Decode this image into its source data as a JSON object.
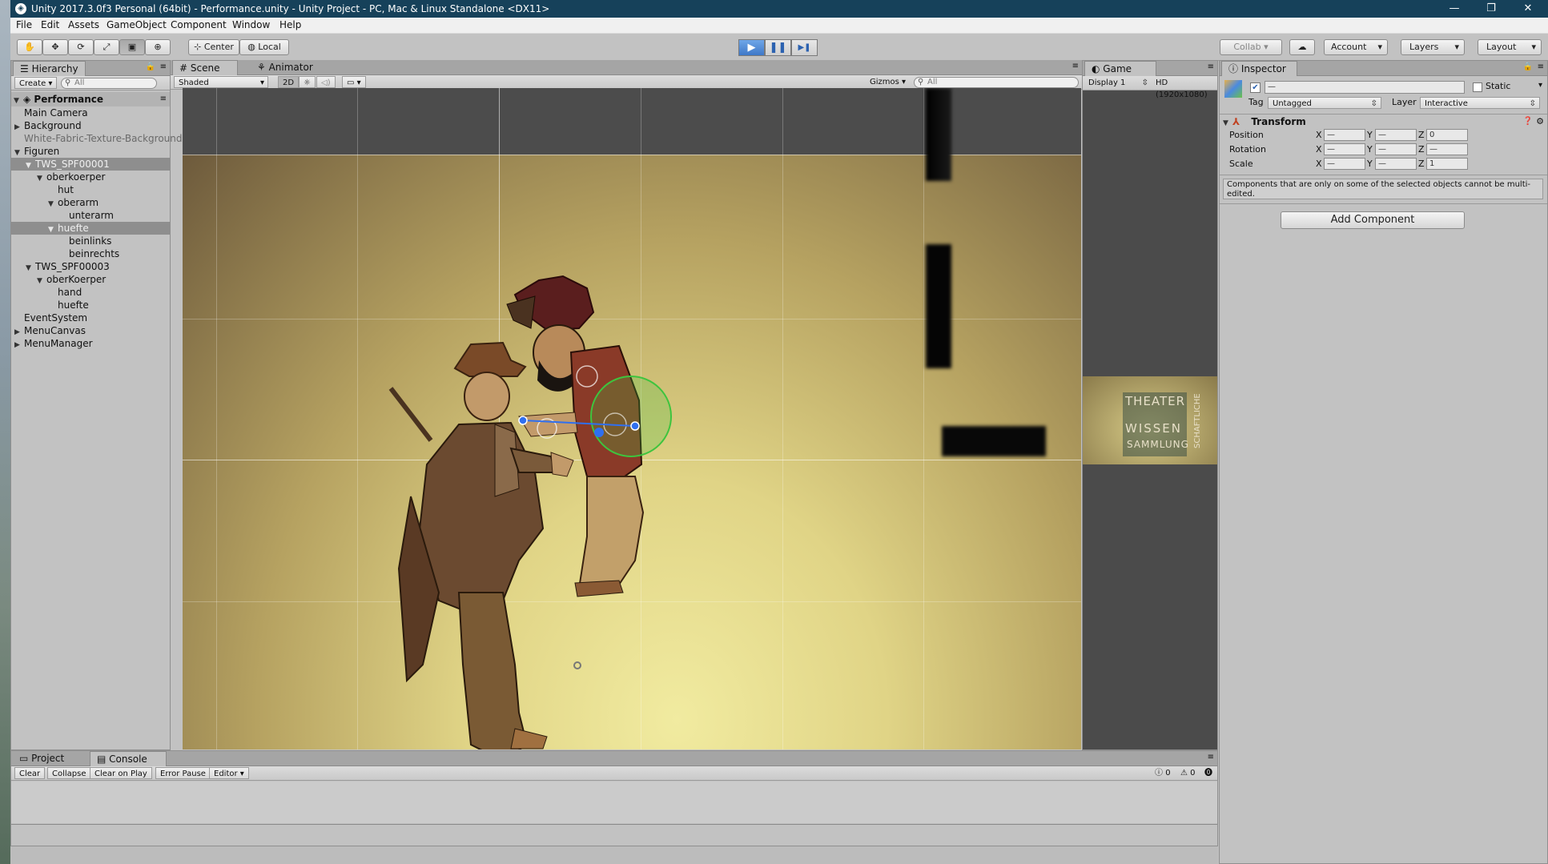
{
  "window": {
    "title": "Unity 2017.3.0f3 Personal (64bit) - Performance.unity - Unity Project - PC, Mac & Linux Standalone <DX11>",
    "app_icon": "unity-icon",
    "min": "—",
    "max": "❐",
    "close": "✕"
  },
  "menu": [
    "File",
    "Edit",
    "Assets",
    "GameObject",
    "Component",
    "Window",
    "Help"
  ],
  "toolbar": {
    "tools": [
      {
        "icon": "hand-tool-icon",
        "glyph": "✋"
      },
      {
        "icon": "move-tool-icon",
        "glyph": "✥"
      },
      {
        "icon": "rotate-tool-icon",
        "glyph": "⟳"
      },
      {
        "icon": "scale-tool-icon",
        "glyph": "⤢"
      },
      {
        "icon": "rect-tool-icon",
        "glyph": "▣"
      },
      {
        "icon": "transform-tool-icon",
        "glyph": "⊕"
      }
    ],
    "pivot": "Center",
    "space": "Local",
    "play": "▶",
    "pause": "❚❚",
    "step": "▶❚",
    "collab": "Collab ▾",
    "cloud": "☁",
    "account": "Account",
    "layers": "Layers",
    "layout": "Layout"
  },
  "hierarchy": {
    "tab": "Hierarchy",
    "create": "Create ▾",
    "search": "All",
    "scene": "Performance",
    "items": [
      {
        "label": "Main Camera",
        "depth": 1,
        "arrow": "",
        "state": ""
      },
      {
        "label": "Background",
        "depth": 1,
        "arrow": "▶",
        "state": ""
      },
      {
        "label": "White-Fabric-Texture-Background",
        "depth": 1,
        "arrow": "",
        "state": "dim"
      },
      {
        "label": "Figuren",
        "depth": 1,
        "arrow": "▼",
        "state": ""
      },
      {
        "label": "TWS_SPF00001",
        "depth": 2,
        "arrow": "▼",
        "state": "sel"
      },
      {
        "label": "oberkoerper",
        "depth": 3,
        "arrow": "▼",
        "state": ""
      },
      {
        "label": "hut",
        "depth": 4,
        "arrow": "",
        "state": ""
      },
      {
        "label": "oberarm",
        "depth": 4,
        "arrow": "▼",
        "state": ""
      },
      {
        "label": "unterarm",
        "depth": 5,
        "arrow": "",
        "state": ""
      },
      {
        "label": "huefte",
        "depth": 4,
        "arrow": "▼",
        "state": "sel"
      },
      {
        "label": "beinlinks",
        "depth": 5,
        "arrow": "",
        "state": ""
      },
      {
        "label": "beinrechts",
        "depth": 5,
        "arrow": "",
        "state": ""
      },
      {
        "label": "TWS_SPF00003",
        "depth": 2,
        "arrow": "▼",
        "state": ""
      },
      {
        "label": "oberKoerper",
        "depth": 3,
        "arrow": "▼",
        "state": ""
      },
      {
        "label": "hand",
        "depth": 4,
        "arrow": "",
        "state": ""
      },
      {
        "label": "huefte",
        "depth": 4,
        "arrow": "",
        "state": ""
      },
      {
        "label": "EventSystem",
        "depth": 1,
        "arrow": "",
        "state": ""
      },
      {
        "label": "MenuCanvas",
        "depth": 1,
        "arrow": "▶",
        "state": ""
      },
      {
        "label": "MenuManager",
        "depth": 1,
        "arrow": "▶",
        "state": ""
      }
    ]
  },
  "scene_view": {
    "tabs": [
      "Scene",
      "Animator"
    ],
    "shading": "Shaded",
    "mode2d": "2D",
    "gizmos": "Gizmos ▾",
    "search": "All"
  },
  "game_view": {
    "tab": "Game",
    "display": "Display 1",
    "resolution": "HD (1920x1080)",
    "thumb_lines": [
      "THEATER",
      "WISSEN",
      "SAMMLUNG"
    ],
    "thumb_side": "SCHAFTLICHE"
  },
  "inspector": {
    "tab": "Inspector",
    "name_value": "—",
    "static": "Static",
    "tag_label": "Tag",
    "tag_value": "Untagged",
    "layer_label": "Layer",
    "layer_value": "Interactive",
    "transform": "Transform",
    "rows": [
      {
        "label": "Position",
        "x": "—",
        "y": "—",
        "z": "0"
      },
      {
        "label": "Rotation",
        "x": "—",
        "y": "—",
        "z": "—"
      },
      {
        "label": "Scale",
        "x": "—",
        "y": "—",
        "z": "1"
      }
    ],
    "axes": [
      "X",
      "Y",
      "Z"
    ],
    "notice": "Components that are only on some of the selected objects cannot be multi-edited.",
    "add_component": "Add Component"
  },
  "console": {
    "tabs": [
      "Project",
      "Console"
    ],
    "buttons": [
      "Clear",
      "Collapse",
      "Clear on Play",
      "Error Pause",
      "Editor ▾"
    ],
    "counts": [
      {
        "icon": "info-icon",
        "glyph": "ⓘ",
        "value": "0"
      },
      {
        "icon": "warning-icon",
        "glyph": "⚠",
        "value": "0"
      },
      {
        "icon": "error-icon",
        "glyph": "⓿",
        "value": "0"
      }
    ]
  },
  "colors": {
    "titlebar": "#16415a",
    "play_active": "#3f78c8",
    "selection": "#8e8e8e",
    "gizmo_green": "#3ec43e",
    "gizmo_blue": "#2f6ff0"
  }
}
